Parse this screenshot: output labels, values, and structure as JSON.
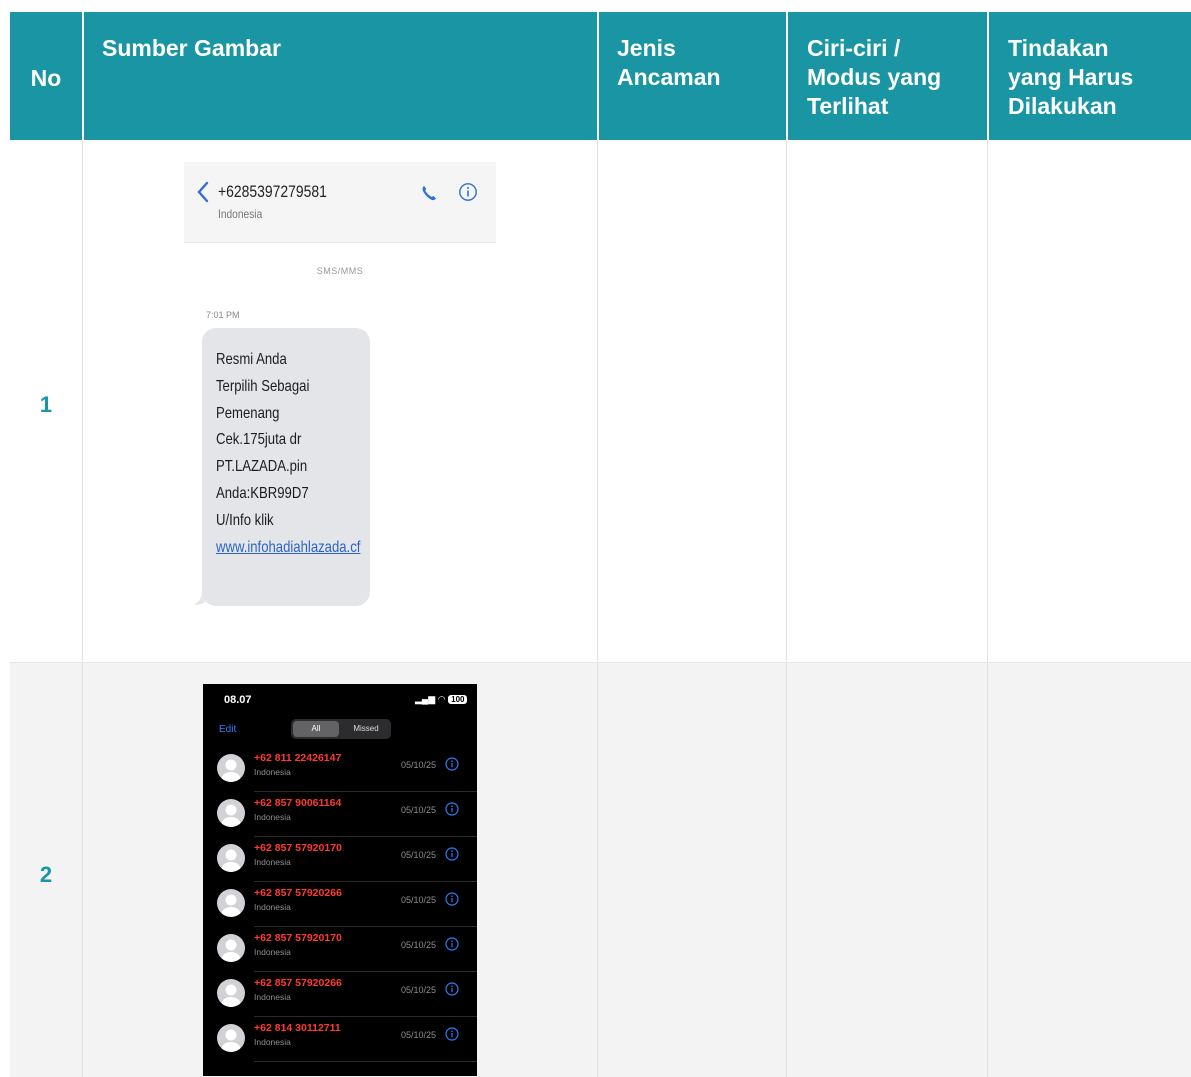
{
  "table": {
    "headers": [
      "No",
      "Sumber Gambar",
      "Jenis\nAncaman",
      "Ciri-ciri /\nModus yang\nTerlihat",
      "Tindakan\nyang Harus\nDilakukan"
    ],
    "header_lines": {
      "no": "No",
      "sumber": "Sumber Gambar",
      "jenis": [
        "Jenis",
        "Ancaman"
      ],
      "ciri": [
        "Ciri-ciri /",
        "Modus yang",
        "Terlihat"
      ],
      "tindakan": [
        "Tindakan",
        "yang Harus",
        "Dilakukan"
      ]
    },
    "rows": [
      {
        "no": "1",
        "jenis_ancaman": "",
        "ciri_ciri": "",
        "tindakan": ""
      },
      {
        "no": "2",
        "jenis_ancaman": "",
        "ciri_ciri": "",
        "tindakan": ""
      }
    ]
  },
  "colors": {
    "header_bg": "#1a95a3",
    "row_number": "#1a95a3",
    "missed_call": "#ff3b30"
  },
  "sms": {
    "sender": "+6285397279581",
    "country": "Indonesia",
    "type_label": "SMS/MMS",
    "time": "7:01 PM",
    "message_lines": [
      "Resmi Anda",
      "Terpilih Sebagai",
      "Pemenang",
      "Cek.175juta dr",
      "PT.LAZADA.pin",
      "Anda:KBR99D7",
      "U/Info klik"
    ],
    "link": "www.infohadiahlazada.cf",
    "icons": [
      "back-chevron-icon",
      "phone-icon",
      "info-icon"
    ]
  },
  "calls": {
    "clock": "08.07",
    "battery": "100",
    "edit_label": "Edit",
    "tab_all": "All",
    "tab_missed": "Missed",
    "entries": [
      {
        "number": "+62 811 22426147",
        "country": "Indonesia",
        "date": "05/10/25"
      },
      {
        "number": "+62 857 90061164",
        "country": "Indonesia",
        "date": "05/10/25"
      },
      {
        "number": "+62 857 57920170",
        "country": "Indonesia",
        "date": "05/10/25"
      },
      {
        "number": "+62 857 57920266",
        "country": "Indonesia",
        "date": "05/10/25"
      },
      {
        "number": "+62 857 57920170",
        "country": "Indonesia",
        "date": "05/10/25"
      },
      {
        "number": "+62 857 57920266",
        "country": "Indonesia",
        "date": "05/10/25"
      },
      {
        "number": "+62 814 30112711",
        "country": "Indonesia",
        "date": "05/10/25"
      }
    ]
  }
}
